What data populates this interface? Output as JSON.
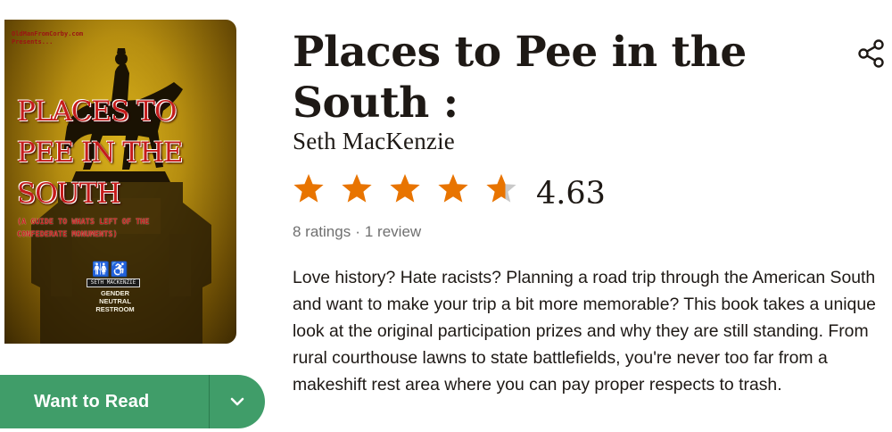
{
  "book": {
    "title_line1": "Places to Pee in the",
    "title_line2": "South :",
    "author": "Seth MacKenzie",
    "rating": "4.63",
    "rating_fraction": 0.926,
    "ratings_count": "8 ratings",
    "reviews_count": "1 review",
    "description": "Love history? Hate racists? Planning a road trip through the American South and want to make your trip a bit more memorable? This book takes a unique look at the original participation prizes and why they are still standing. From rural courthouse lawns to state battlefields, you're never too far from a makeshift rest area where you can pay proper respects to trash."
  },
  "cover": {
    "site_line1": "OldManFromCorby.com",
    "site_line2": "Presents...",
    "title_line1": "PLACES TO",
    "title_line2": "PEE IN THE",
    "title_line3": "SOUTH",
    "subtitle_line1": "(A GUIDE TO WHATS LEFT OF THE",
    "subtitle_line2": "CONFEDERATE MONUMENTS)",
    "author_plate": "SETH MACKENZIE",
    "sign_line1": "GENDER",
    "sign_line2": "NEUTRAL",
    "sign_line3": "RESTROOM"
  },
  "actions": {
    "want_to_read": "Want to Read"
  },
  "icons": {
    "share": "share-icon",
    "dropdown": "chevron-down-icon",
    "star": "star-icon"
  },
  "colors": {
    "star_fill": "#e87400",
    "star_empty": "#c9c9c9",
    "button": "#409d69",
    "text": "#1e1915",
    "muted": "#707070"
  }
}
